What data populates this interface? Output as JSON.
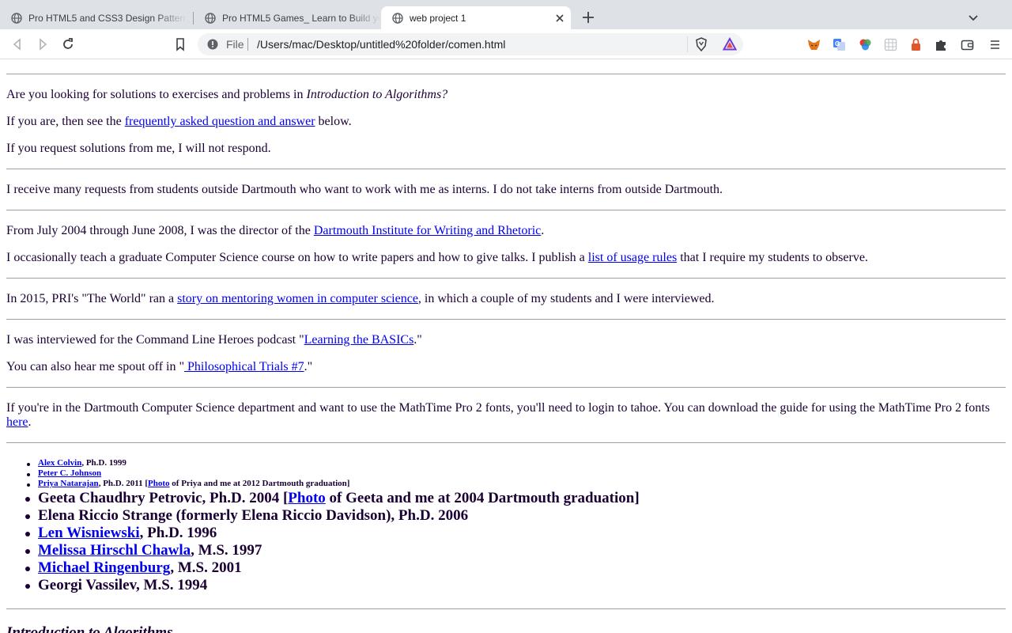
{
  "browser": {
    "tabs": [
      {
        "title": "Pro HTML5 and CSS3 Design Patterns"
      },
      {
        "title": "Pro HTML5 Games_ Learn to Build your Own Games"
      },
      {
        "title": "web project 1"
      }
    ],
    "address": {
      "scheme": "File",
      "url": "/Users/mac/Desktop/untitled%20folder/comen.html"
    },
    "extensions": [
      "metamask-fox-icon",
      "google-translate-icon",
      "color-wheel-icon",
      "grid-extension-icon",
      "lock-extension-icon",
      "puzzle-icon",
      "wallet-icon",
      "menu-icon"
    ],
    "colors": {
      "tabstrip": "#dee1e6",
      "link": "#0000ee",
      "text": "#1a0033"
    }
  },
  "page": {
    "p_solutions_pre": "Are you looking for solutions to exercises and problems in ",
    "p_solutions_book": "Introduction to Algorithms?",
    "p_faq_pre": "If you are, then see the ",
    "p_faq_link": "frequently asked question and answer",
    "p_faq_post": " below.",
    "p_no_respond": "If you request solutions from me, I will not respond.",
    "p_interns": "I receive many requests from students outside Dartmouth who want to work with me as interns. I do not take interns from outside Dartmouth.",
    "p_director_pre": "From July 2004 through June 2008, I was the director of the ",
    "p_director_link": "Dartmouth Institute for Writing and Rhetoric",
    "p_director_post": ".",
    "p_teach_pre": "I occasionally teach a graduate Computer Science course on how to write papers and how to give talks. I publish a ",
    "p_teach_link": "list of usage rules",
    "p_teach_post": " that I require my students to observe.",
    "p_pri_pre": "In 2015, PRI's \"The World\" ran a ",
    "p_pri_link": "story on mentoring women in computer science",
    "p_pri_post": ", in which a couple of my students and I were interviewed.",
    "p_podcast_pre": "I was interviewed for the Command Line Heroes podcast \"",
    "p_podcast_link": "Learning the BASICs",
    "p_podcast_post": ".\"",
    "p_phil_pre": "You can also hear me spout off in \"",
    "p_phil_link": " Philosophical Trials #7",
    "p_phil_post": ".\"",
    "p_mathtime": "If you're in the Dartmouth Computer Science department and want to use the MathTime Pro 2 fonts, you'll need to login to tahoe. You can download the guide for using the MathTime Pro 2 fonts ",
    "p_mathtime_link": "here",
    "p_mathtime_post": ".",
    "students_small": [
      {
        "link": "Alex Colvin",
        "rest": ", Ph.D. 1999"
      },
      {
        "link": "Peter C. Johnson",
        "rest": ""
      },
      {
        "link": "Priya Natarajan",
        "rest": ", Ph.D. 2011 [",
        "photo": "Photo",
        "rest2": " of Priya and me at 2012 Dartmouth graduation]"
      }
    ],
    "students_big": [
      {
        "text": "Geeta Chaudhry Petrovic, Ph.D. 2004 [",
        "photo": "Photo",
        "rest2": " of Geeta and me at 2004 Dartmouth graduation]"
      },
      {
        "text": "Elena Riccio Strange (formerly Elena Riccio Davidson), Ph.D. 2006"
      },
      {
        "link": "Len Wisniewski",
        "rest": ", Ph.D. 1996"
      },
      {
        "link": "Melissa Hirschl Chawla",
        "rest": ", M.S. 1997"
      },
      {
        "link": "Michael Ringenburg",
        "rest": ", M.S. 2001"
      },
      {
        "text": "Georgi Vassilev, M.S. 1994"
      }
    ],
    "footer_heading": "Introduction to Algorithms"
  }
}
